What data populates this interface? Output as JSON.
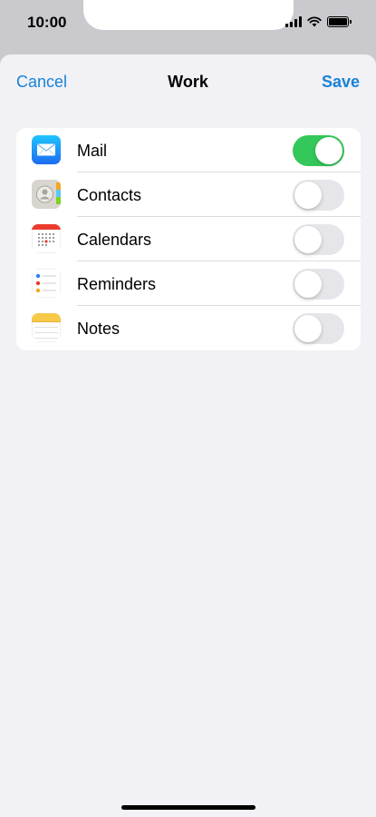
{
  "status_bar": {
    "time": "10:00"
  },
  "nav": {
    "cancel_label": "Cancel",
    "title": "Work",
    "save_label": "Save"
  },
  "colors": {
    "accent": "#1a82d6",
    "toggle_on": "#34c759",
    "toggle_off": "#e6e6ea",
    "background": "#f1f1f6"
  },
  "items": [
    {
      "label": "Mail",
      "icon": "mail-icon",
      "enabled": true
    },
    {
      "label": "Contacts",
      "icon": "contacts-icon",
      "enabled": false
    },
    {
      "label": "Calendars",
      "icon": "calendar-icon",
      "enabled": false
    },
    {
      "label": "Reminders",
      "icon": "reminders-icon",
      "enabled": false
    },
    {
      "label": "Notes",
      "icon": "notes-icon",
      "enabled": false
    }
  ]
}
